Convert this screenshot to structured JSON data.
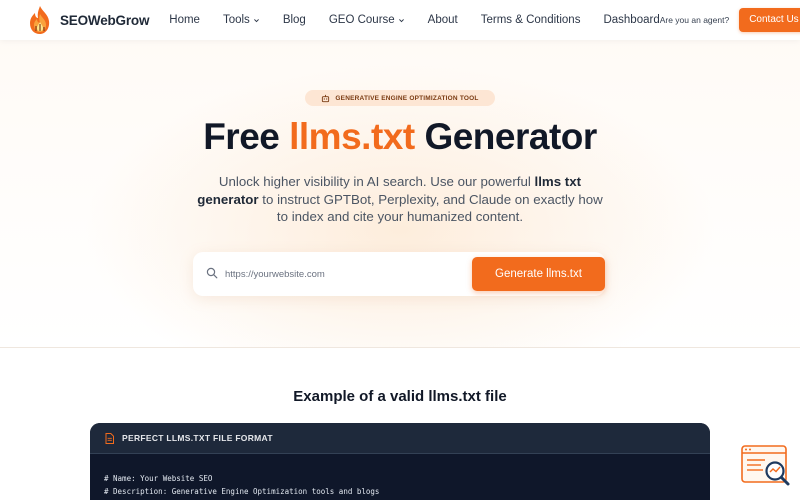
{
  "navbar": {
    "brand": "SEOWebGrow",
    "items": [
      {
        "label": "Home",
        "has_dropdown": false
      },
      {
        "label": "Tools",
        "has_dropdown": true
      },
      {
        "label": "Blog",
        "has_dropdown": false
      },
      {
        "label": "GEO Course",
        "has_dropdown": true
      },
      {
        "label": "About",
        "has_dropdown": false
      },
      {
        "label": "Terms & Conditions",
        "has_dropdown": false
      },
      {
        "label": "Dashboard",
        "has_dropdown": false
      }
    ],
    "agent_question": "Are you an agent?",
    "contact_label": "Contact Us"
  },
  "hero": {
    "badge": "GENERATIVE ENGINE OPTIMIZATION TOOL",
    "title_prefix": "Free",
    "title_accent": "llms.txt",
    "title_suffix": "Generator",
    "subtitle_pre": "Unlock higher visibility in AI search. Use our powerful",
    "subtitle_bold": "llms txt generator",
    "subtitle_post": "to instruct GPTBot, Perplexity, and Claude on exactly how to index and cite your humanized content.",
    "search": {
      "placeholder": "https://yourwebsite.com",
      "value": ""
    },
    "generate_label": "Generate llms.txt"
  },
  "example": {
    "title": "Example of a valid llms.txt file",
    "card_header": "PERFECT LLMS.TXT FILE FORMAT",
    "lines": [
      "# Name: Your Website SEO",
      "# Description: Generative Engine Optimization tools and blogs"
    ]
  },
  "colors": {
    "accent": "#f26b1d",
    "code_bg": "#0f172a",
    "code_header_bg": "#1e293b"
  },
  "icons": {
    "logo": "flame-logo-icon",
    "search": "search-icon",
    "file": "file-icon",
    "widget": "search-document-icon"
  }
}
